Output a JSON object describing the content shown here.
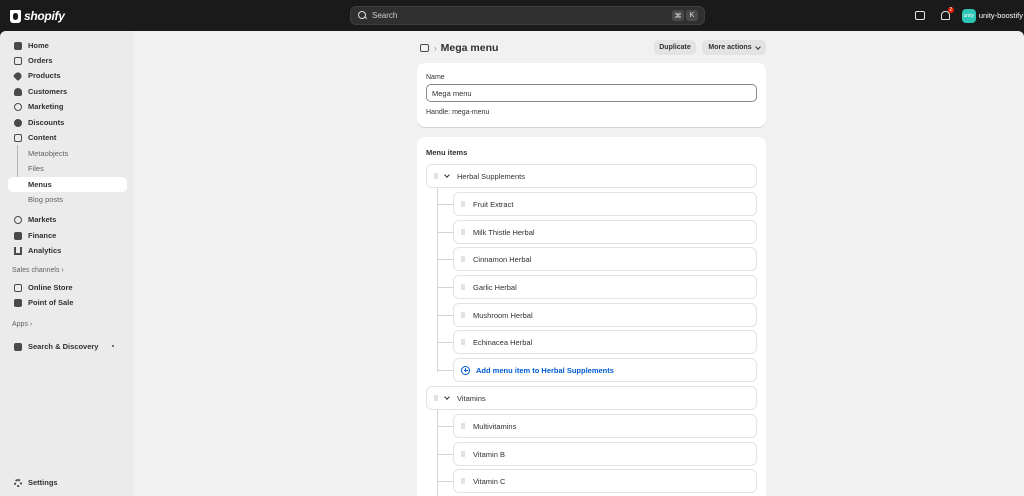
{
  "topbar": {
    "logo_text": "shopify",
    "search_placeholder": "Search",
    "shortcut_key1": "⌘",
    "shortcut_key2": "K",
    "notification_count": "2",
    "avatar_text": "unity",
    "store_name": "unity-boostify"
  },
  "sidebar": {
    "items": [
      {
        "label": "Home",
        "icon": "home-icon"
      },
      {
        "label": "Orders",
        "icon": "inbox-icon"
      },
      {
        "label": "Products",
        "icon": "tag-icon"
      },
      {
        "label": "Customers",
        "icon": "person-icon"
      },
      {
        "label": "Marketing",
        "icon": "target-icon"
      },
      {
        "label": "Discounts",
        "icon": "discount-icon"
      },
      {
        "label": "Content",
        "icon": "content-icon"
      }
    ],
    "content_sub": [
      "Metaobjects",
      "Files",
      "Menus",
      "Blog posts"
    ],
    "items2": [
      {
        "label": "Markets",
        "icon": "globe-icon"
      },
      {
        "label": "Finance",
        "icon": "bank-icon"
      },
      {
        "label": "Analytics",
        "icon": "chart-icon"
      }
    ],
    "sales_channels_label": "Sales channels ›",
    "channels": [
      "Online Store",
      "Point of Sale"
    ],
    "apps_label": "Apps ›",
    "apps": [
      "Search & Discovery"
    ],
    "settings": "Settings"
  },
  "header": {
    "breadcrumb_sep": "›",
    "title": "Mega menu",
    "duplicate": "Duplicate",
    "more_actions": "More actions"
  },
  "name_card": {
    "label": "Name",
    "value": "Mega menu",
    "handle": "Handle: mega-menu"
  },
  "menu_card": {
    "title": "Menu items",
    "groups": [
      {
        "label": "Herbal Supplements",
        "children": [
          "Fruit Extract",
          "Milk Thistle Herbal",
          "Cinnamon Herbal",
          "Garlic Herbal",
          "Mushroom Herbal",
          "Echinacea Herbal"
        ],
        "add_label": "Add menu item to Herbal Supplements"
      },
      {
        "label": "Vitamins",
        "children": [
          "Multivitamins",
          "Vitamin B",
          "Vitamin C"
        ]
      }
    ]
  },
  "colors": {
    "accent": "#005bd3",
    "topbar": "#1a1a1a",
    "background": "#f1f1f1",
    "sidebar": "#ebebeb",
    "avatar": "#2ec4b6"
  }
}
